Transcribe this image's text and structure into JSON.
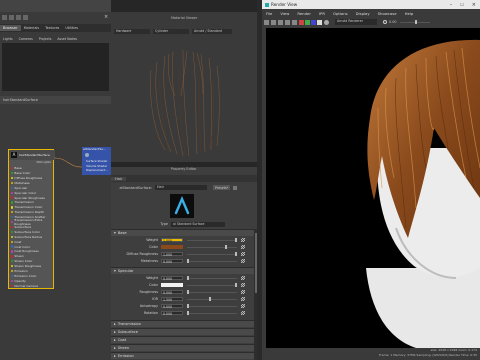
{
  "left_panel": {
    "title": "Hypershade",
    "tabs": [
      "Browser",
      "Materials",
      "Textures",
      "Utilities",
      "Rendering",
      "Lights",
      "Cameras",
      "Projects",
      "Asset Nodes"
    ],
    "active_tab": "Browser",
    "lower_tab": "hairStandardSurface",
    "node_title": "hairStandardSurface",
    "node_tag": "Mat Lights",
    "attributes": [
      "Base",
      "Base Color",
      "Diffuse Roughness",
      "Metalness",
      "Specular",
      "Specular Color",
      "Specular Roughness",
      "Transmission",
      "Transmission Color",
      "Transmission Depth",
      "Transmission Scatter",
      "Transmission Extra Roughness",
      "Subsurface",
      "Subsurface Color",
      "Subsurface Radius",
      "Coat",
      "Coat Color",
      "Coat Roughness",
      "Sheen",
      "Sheen Color",
      "Sheen Roughness",
      "Emission",
      "Emission Color",
      "Opacity",
      "Normal Camera"
    ],
    "small_node": {
      "title": "aiStandardSu...",
      "ports": [
        "Surface Shader",
        "Volume Shader",
        "Displacement..."
      ]
    }
  },
  "center_top": {
    "title": "Material Viewer",
    "dropdowns": [
      "Hardware",
      "Cylinder",
      "Arnold / Standard"
    ]
  },
  "property_editor": {
    "title": "Property Editor",
    "tab": "Hair",
    "field_label": "aiStandardSurface:",
    "field_value": "Hair",
    "presets_label": "Presets*",
    "type_label": "Type",
    "type_value": "ai Standard Surface",
    "base_section": "Base",
    "base_rows": [
      {
        "label": "Weight",
        "value": "1.000"
      },
      {
        "label": "Color",
        "value": ""
      },
      {
        "label": "Diffuse Roughness",
        "value": "1.000"
      },
      {
        "label": "Metalness",
        "value": "0.000"
      }
    ],
    "specular_section": "Specular",
    "specular_rows": [
      {
        "label": "Weight",
        "value": "0.000"
      },
      {
        "label": "Color",
        "value": ""
      },
      {
        "label": "Roughness",
        "value": "0.000"
      },
      {
        "label": "IOR",
        "value": "1.500"
      },
      {
        "label": "Anisotropy",
        "value": "0.000"
      },
      {
        "label": "Rotation",
        "value": "0.000"
      }
    ],
    "collapsed_sections": [
      "Transmission",
      "Subsurface",
      "Coat",
      "Sheen",
      "Emission"
    ]
  },
  "render_view": {
    "title": "Render View",
    "menu": [
      "File",
      "View",
      "Render",
      "IPR",
      "Options",
      "Display",
      "Showcase",
      "Help"
    ],
    "camera": "Arnold Renderer",
    "exposure": "0.00",
    "status": "size: 2048 x 2048 zoom: 0.174",
    "status2": "Frame: 1   Memory: 37Mb   Sampling: [0/0/0/0/0]   Render Time: 0:35"
  },
  "colors": {
    "accent": "#e6b800",
    "node_blue": "#3553a8",
    "viewport": "#000000",
    "hair": "#8a4a1c"
  }
}
